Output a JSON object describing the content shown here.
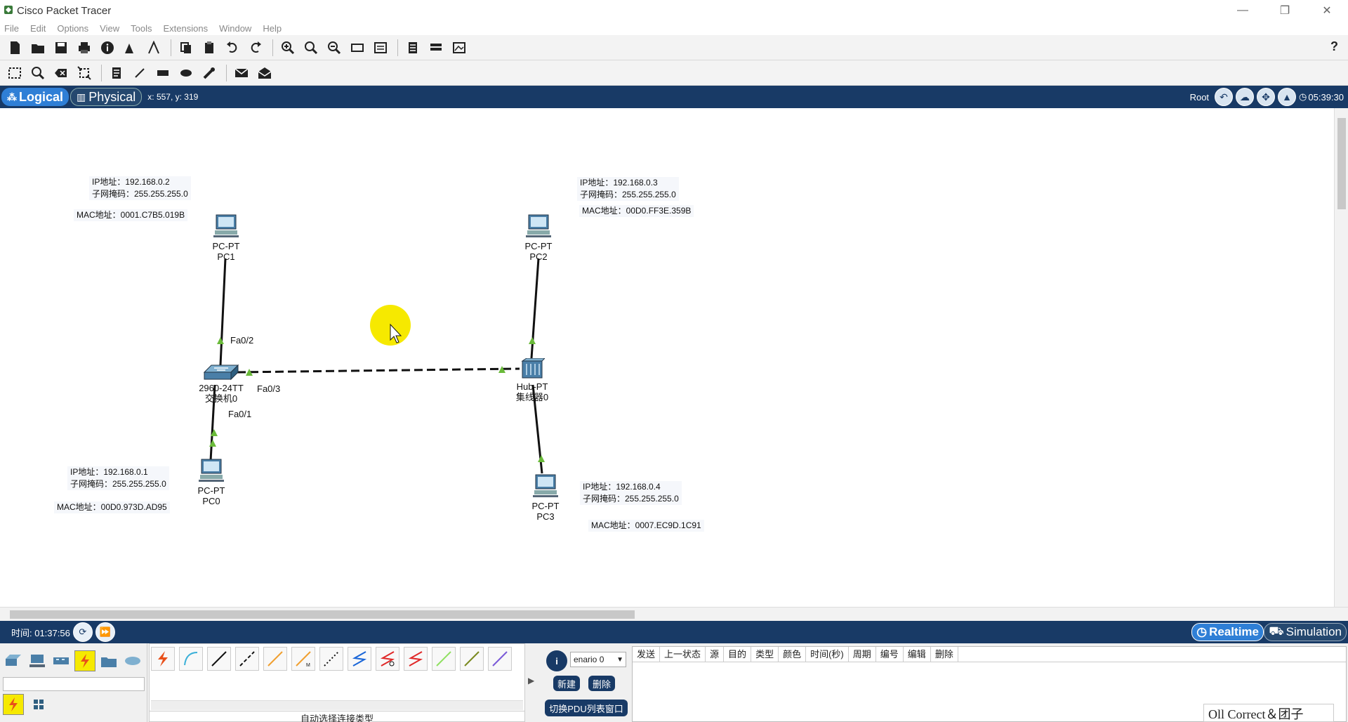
{
  "window": {
    "title": "Cisco Packet Tracer",
    "minimize": "—",
    "restore": "❐",
    "close": "✕"
  },
  "menu": [
    "File",
    "Edit",
    "Options",
    "View",
    "Tools",
    "Extensions",
    "Window",
    "Help"
  ],
  "toolbar_main": [
    "new-file-icon",
    "open-folder-icon",
    "save-icon",
    "print-icon",
    "info-icon",
    "network-wizard-icon",
    "activity-wizard-icon",
    "copy-icon",
    "paste-icon",
    "undo-icon",
    "redo-icon",
    "zoom-in-icon",
    "zoom-reset-icon",
    "zoom-out-icon",
    "drawing-palette-icon",
    "custom-device-icon",
    "pdu-list-icon",
    "cluster-icon",
    "screenshot-icon"
  ],
  "help": "?",
  "toolbar_tools": [
    "select-icon",
    "inspect-icon",
    "delete-icon",
    "resize-icon",
    "note-icon",
    "line-icon",
    "rectangle-icon",
    "ellipse-icon",
    "freeform-icon",
    "simple-pdu-icon",
    "complex-pdu-icon"
  ],
  "mode": {
    "logical": "Logical",
    "physical": "Physical",
    "coords": "x: 557, y: 319",
    "root": "Root",
    "clock": "05:39:30"
  },
  "devices": [
    {
      "type": "PC-PT",
      "name": "PC1"
    },
    {
      "type": "PC-PT",
      "name": "PC2"
    },
    {
      "type": "2960-24TT",
      "name": "交换机0"
    },
    {
      "type": "Hub-PT",
      "name": "集线器0"
    },
    {
      "type": "PC-PT",
      "name": "PC0"
    },
    {
      "type": "PC-PT",
      "name": "PC3"
    }
  ],
  "notes": [
    {
      "ip": "IP地址：192.168.0.2",
      "mask": "子网掩码：255.255.255.0",
      "mac": "MAC地址：0001.C7B5.019B"
    },
    {
      "ip": "IP地址：192.168.0.3",
      "mask": "子网掩码：255.255.255.0",
      "mac": "MAC地址：00D0.FF3E.359B"
    },
    {
      "ip": "IP地址：192.168.0.1",
      "mask": "子网掩码：255.255.255.0",
      "mac": "MAC地址：00D0.973D.AD95"
    },
    {
      "ip": "IP地址：192.168.0.4",
      "mask": "子网掩码：255.255.255.0",
      "mac": "MAC地址：0007.EC9D.1C91"
    }
  ],
  "ports": [
    "Fa0/2",
    "Fa0/3",
    "Fa0/1"
  ],
  "bottom": {
    "time": "时间: 01:37:56",
    "realtime": "Realtime",
    "simulation": "Simulation",
    "conn_auto_label": "自动选择连接类型"
  },
  "pdu": {
    "scenario": "enario 0",
    "new": "新建",
    "delete": "删除",
    "toggle": "切换PDU列表窗口",
    "headers": [
      "发送",
      "上一状态",
      "源",
      "目的",
      "类型",
      "颜色",
      "时间(秒)",
      "周期",
      "编号",
      "编辑",
      "删除"
    ]
  },
  "watermark": "Oll Correct＆团子",
  "colors": {
    "modebar": "#183a66",
    "active_tab": "#2f7fd6",
    "link_ok": "#6aba3a",
    "cursor_highlight": "#f6e900"
  }
}
